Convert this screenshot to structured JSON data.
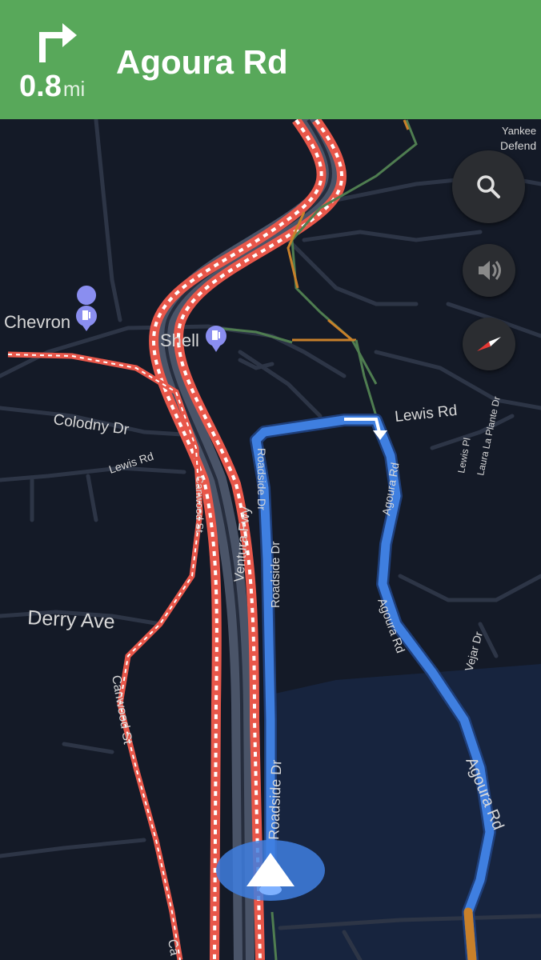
{
  "banner": {
    "distance": "0.8",
    "unit": "mi",
    "street": "Agoura Rd",
    "maneuver_icon": "turn-right-arrow-icon",
    "color": "#58a85a"
  },
  "map": {
    "labels": {
      "chevron": "Chevron",
      "shell": "Shell",
      "colodny": "Colodny Dr",
      "lewis_left": "Lewis Rd",
      "lewis_right": "Lewis Rd",
      "derry": "Derry Ave",
      "canwood_upper": "Canwood St",
      "canwood_lower": "Canwood St",
      "canwood_bottom": "Ca",
      "ventura": "Ventura Fwy",
      "roadside_upper": "Roadside Dr",
      "roadside_mid": "Roadside Dr",
      "roadside_lower": "Roadside Dr",
      "agoura_upper": "Agoura Rd",
      "agoura_mid": "Agoura Rd",
      "agoura_lower": "Agoura Rd",
      "vejar": "Vejar Dr",
      "lewis_pl": "Lewis Pl",
      "laura": "Laura La Plante Dr",
      "yankee": "Yankee",
      "defend": "Defend"
    },
    "poi_icons": [
      "gas-station-icon",
      "gas-station-icon"
    ],
    "colors": {
      "route": "#3f7fe0",
      "traffic_heavy": "#e8574a",
      "traffic_moderate": "#c8802a",
      "traffic_clear": "#4f7d50",
      "water_area": "#1a2e52"
    }
  },
  "controls": {
    "search_icon": "search-icon",
    "sound_icon": "speaker-icon",
    "compass_icon": "compass-icon"
  }
}
